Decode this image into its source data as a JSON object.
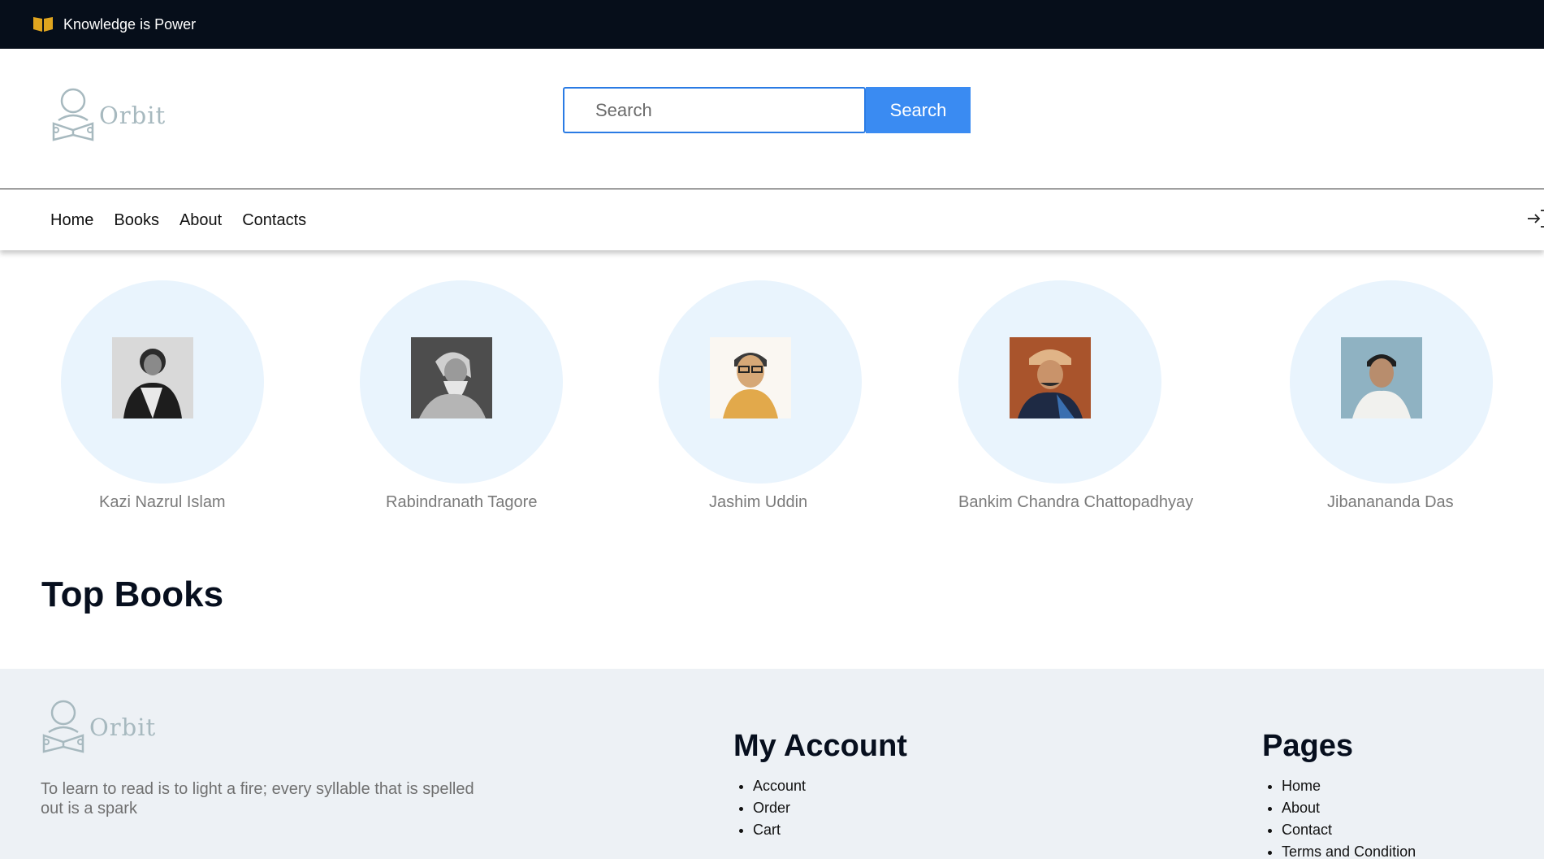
{
  "topbar": {
    "tagline": "Knowledge is Power",
    "accent": "#e0a51f"
  },
  "brand": {
    "name": "Orbit"
  },
  "search": {
    "placeholder": "Search",
    "button_label": "Search"
  },
  "nav": {
    "items": [
      "Home",
      "Books",
      "About",
      "Contacts"
    ],
    "login_icon": "login-icon"
  },
  "authors": [
    {
      "name": "Kazi Nazrul Islam"
    },
    {
      "name": "Rabindranath Tagore"
    },
    {
      "name": "Jashim Uddin"
    },
    {
      "name": "Bankim Chandra Chattopadhyay"
    },
    {
      "name": "Jibanananda Das"
    }
  ],
  "sections": {
    "top_books_title": "Top Books"
  },
  "footer": {
    "quote": "To learn to read is to light a fire; every syllable that is spelled out is a spark",
    "my_account": {
      "title": "My Account",
      "items": [
        "Account",
        "Order",
        "Cart"
      ]
    },
    "pages": {
      "title": "Pages",
      "items": [
        "Home",
        "About",
        "Contact",
        "Terms and Condition"
      ]
    }
  }
}
